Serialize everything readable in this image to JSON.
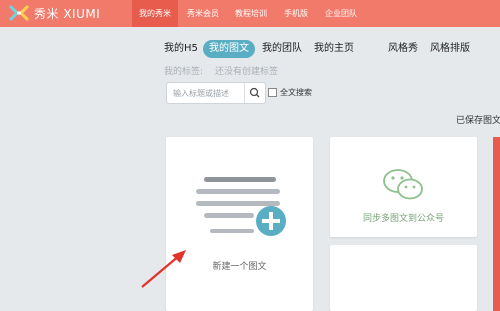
{
  "brand": {
    "name": "秀米 XIUMI"
  },
  "topnav": {
    "items": [
      {
        "label": "我的秀米"
      },
      {
        "label": "秀米会员"
      },
      {
        "label": "教程培训"
      },
      {
        "label": "手机版"
      },
      {
        "label": "企业团队"
      }
    ]
  },
  "tabs": [
    {
      "label": "我的H5"
    },
    {
      "label": "我的图文"
    },
    {
      "label": "我的团队"
    },
    {
      "label": "我的主页"
    },
    {
      "label": "风格秀"
    },
    {
      "label": "风格排版"
    }
  ],
  "tags": {
    "label": "我的标签:",
    "empty": "还没有创建标签"
  },
  "search": {
    "placeholder": "输入标题或描述",
    "fulltext_label": "全文搜索"
  },
  "saved_label": "已保存图文",
  "cards": {
    "new_article": "新建一个图文",
    "sync_wechat": "同步多图文到公众号"
  },
  "colors": {
    "topbar": "#f27a6b",
    "active_nav": "#e85c4d",
    "active_tab": "#5aaec3",
    "wechat_green": "#8cc08c"
  }
}
